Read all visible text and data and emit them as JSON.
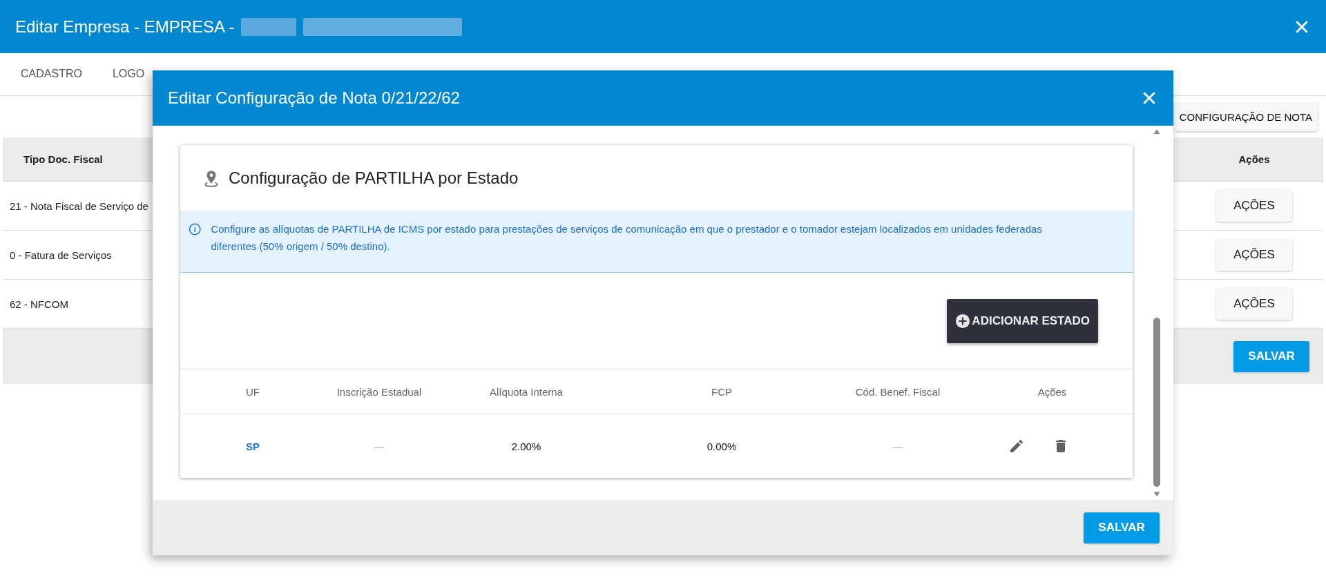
{
  "window": {
    "title": "Editar Empresa - EMPRESA -"
  },
  "tabs": [
    {
      "label": "CADASTRO",
      "selected": false
    },
    {
      "label": "LOGO",
      "selected": false
    }
  ],
  "toolbar": {
    "button": "CONFIGURAÇÃO DE NOTA"
  },
  "table": {
    "columns": [
      "Tipo Doc. Fiscal",
      "Ações"
    ],
    "rows": [
      {
        "tipo": "21 - Nota Fiscal de Serviço de",
        "action": "AÇÕES"
      },
      {
        "tipo": "0 - Fatura de Serviços",
        "action": "AÇÕES"
      },
      {
        "tipo": "62 - NFCOM",
        "action": "AÇÕES"
      }
    ]
  },
  "footer": {
    "button": "SALVAR"
  },
  "dialog": {
    "title": "Editar Configuração de Nota 0/21/22/62",
    "card": {
      "title": "Configuração de PARTILHA por Estado",
      "info": "Configure as alíquotas de PARTILHA de ICMS por estado para prestações de serviços de comunicação em que o prestador e o tomador estejam localizados em unidades federadas diferentes (50% origem / 50% destino).",
      "add_button": "ADICIONAR ESTADO",
      "columns": [
        "UF",
        "Inscrição Estadual",
        "Alíquota Interna",
        "FCP",
        "Cód. Benef. Fiscal",
        "Ações"
      ],
      "rows": [
        {
          "uf": "SP",
          "inscricao": "—",
          "aliquota": "2.00%",
          "fcp": "0.00%",
          "cod_benef": "—"
        }
      ]
    },
    "save_button": "SALVAR"
  }
}
